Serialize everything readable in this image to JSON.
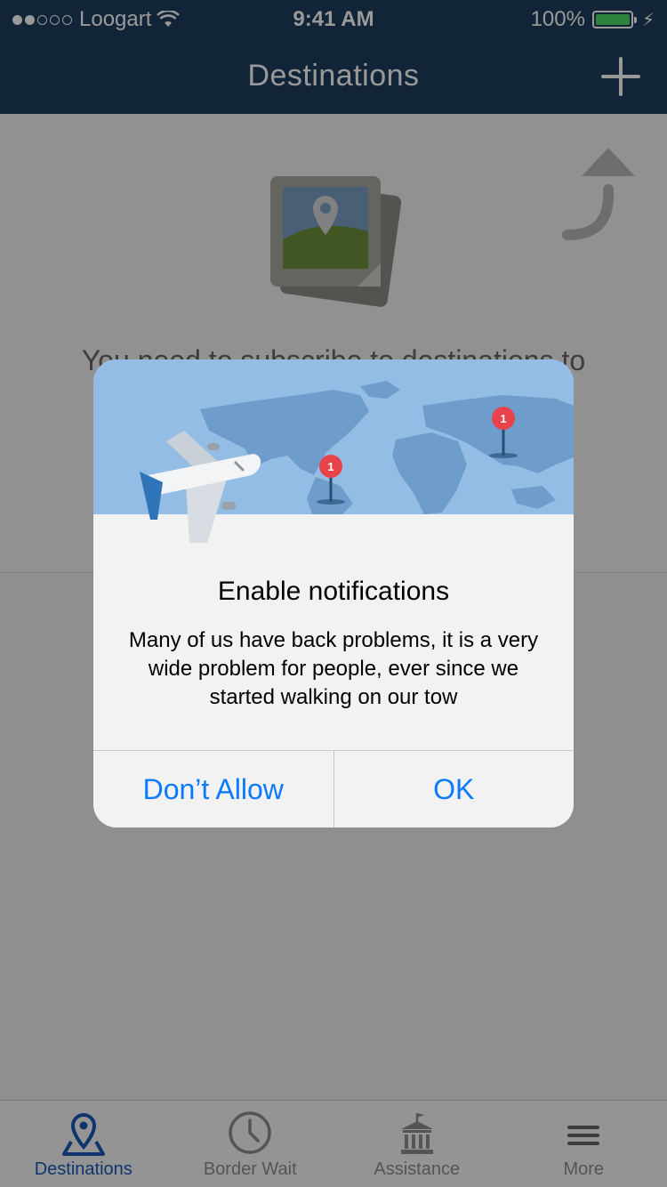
{
  "status_bar": {
    "carrier": "Loogart",
    "time": "9:41 AM",
    "battery": "100%"
  },
  "nav": {
    "title": "Destinations"
  },
  "content": {
    "empty_message": "You need to subscribe to destinations to"
  },
  "alert": {
    "title": "Enable notifications",
    "message": "Many of us have back problems, it is a very wide problem for people, ever since we started walking on our tow",
    "deny_label": "Don’t Allow",
    "ok_label": "OK",
    "pin_badge": "1"
  },
  "tabs": [
    {
      "label": "Destinations",
      "icon": "map-pin-icon",
      "active": true
    },
    {
      "label": "Border Wait",
      "icon": "clock-icon",
      "active": false
    },
    {
      "label": "Assistance",
      "icon": "building-icon",
      "active": false
    },
    {
      "label": "More",
      "icon": "menu-icon",
      "active": false
    }
  ],
  "colors": {
    "nav_bg": "#1e3d5e",
    "accent": "#1a5bb5",
    "alert_button": "#0a7aff",
    "map_sky": "#93bde4",
    "pin": "#e8434a"
  }
}
